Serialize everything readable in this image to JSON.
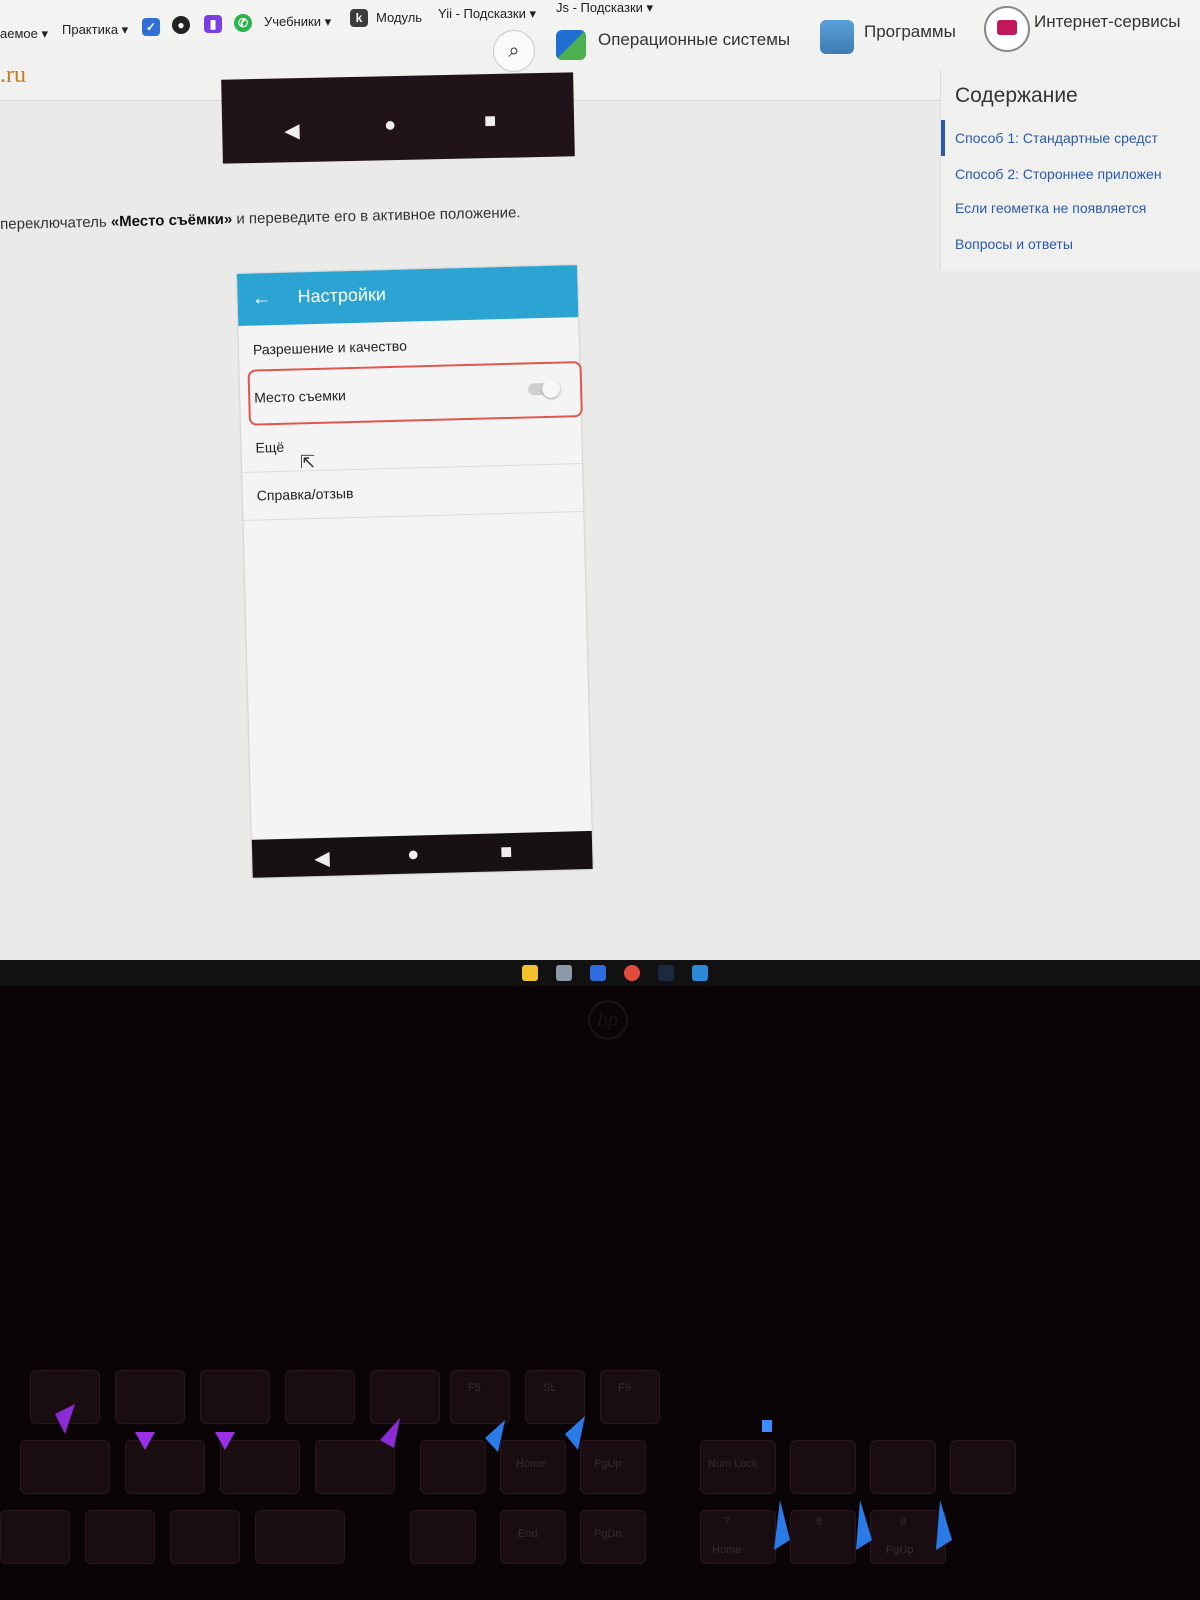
{
  "bookmarks": [
    {
      "label": "аемое ▾"
    },
    {
      "label": "Практика ▾"
    },
    {
      "label": "Учебники ▾"
    },
    {
      "label": "Модуль"
    },
    {
      "label": "Yii - Подсказки ▾"
    },
    {
      "label": "Js - Подсказки ▾"
    }
  ],
  "site": {
    "logo_suffix": ".ru",
    "nav": [
      {
        "label": "Операционные системы"
      },
      {
        "label": "Программы"
      },
      {
        "label": "Интернет-сервисы"
      }
    ]
  },
  "article": {
    "instruction_start": "переключатель ",
    "instruction_bold": "«Место съёмки»",
    "instruction_end": " и переведите его в активное положение."
  },
  "phone": {
    "title": "Настройки",
    "back_icon": "←",
    "rows": [
      {
        "label": "Разрешение и качество"
      },
      {
        "label": "Место съемки"
      },
      {
        "label": "Ещё"
      },
      {
        "label": "Справка/отзыв"
      }
    ],
    "location_toggle_on": false,
    "highlight_color": "#e0574f",
    "bar_color": "#2ba4d4"
  },
  "toc": {
    "title": "Содержание",
    "items": [
      {
        "label": "Способ 1: Стандартные средст"
      },
      {
        "label": "Способ 2: Стороннее приложен"
      },
      {
        "label": "Если геометка не появляется"
      },
      {
        "label": "Вопросы и ответы"
      }
    ]
  },
  "nav_glyphs": {
    "back": "◀",
    "home": "●",
    "recent": "■"
  },
  "laptop": {
    "brand": "hp"
  },
  "keyboard": {
    "labels": [
      "F5",
      "SL",
      "F9",
      "Home",
      "PgUp",
      "Num Lock",
      "End",
      "PgDn",
      "7",
      "Home",
      "8",
      "9",
      "PgUp"
    ]
  }
}
